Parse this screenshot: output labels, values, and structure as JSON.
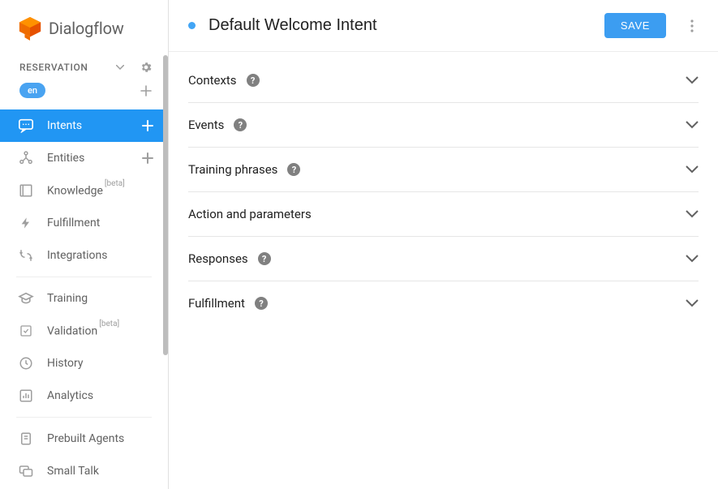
{
  "logo_text": "Dialogflow",
  "agent": {
    "name": "RESERVATION",
    "language": "en"
  },
  "sidebar": {
    "items": [
      {
        "label": "Intents",
        "active": true,
        "has_plus": true
      },
      {
        "label": "Entities",
        "active": false,
        "has_plus": true
      },
      {
        "label": "Knowledge",
        "beta": "[beta]"
      },
      {
        "label": "Fulfillment"
      },
      {
        "label": "Integrations"
      },
      {
        "label": "Training"
      },
      {
        "label": "Validation",
        "beta": "[beta]"
      },
      {
        "label": "History"
      },
      {
        "label": "Analytics"
      },
      {
        "label": "Prebuilt Agents"
      },
      {
        "label": "Small Talk"
      }
    ]
  },
  "header": {
    "title": "Default Welcome Intent",
    "save_label": "SAVE"
  },
  "sections": [
    {
      "title": "Contexts",
      "help": true
    },
    {
      "title": "Events",
      "help": true
    },
    {
      "title": "Training phrases",
      "help": true
    },
    {
      "title": "Action and parameters",
      "help": false
    },
    {
      "title": "Responses",
      "help": true
    },
    {
      "title": "Fulfillment",
      "help": true
    }
  ]
}
